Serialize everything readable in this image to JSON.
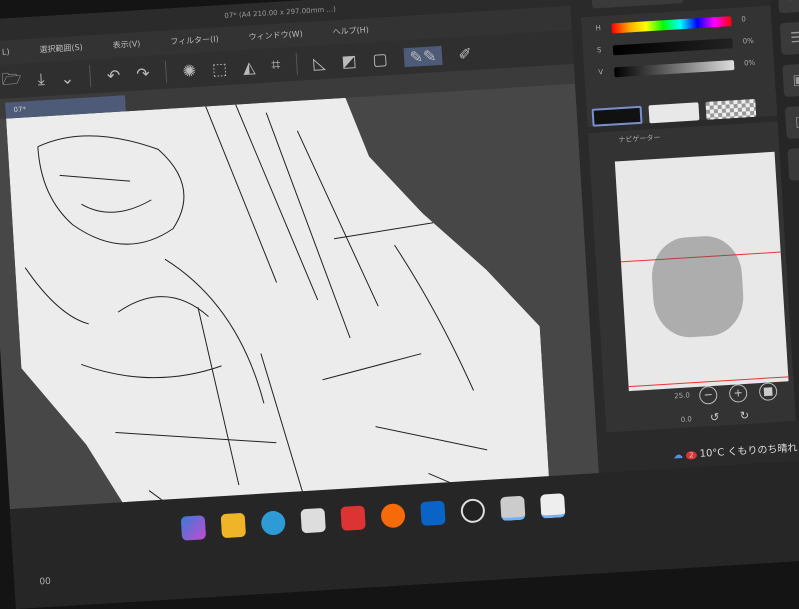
{
  "window": {
    "title": "07* (A4 210.00 x 297.00mm ...)"
  },
  "menu": [
    "L)",
    "選択範囲(S)",
    "表示(V)",
    "フィルター(I)",
    "ウィンドウ(W)",
    "ヘルプ(H)"
  ],
  "tab": {
    "label": "07*"
  },
  "color_panel": {
    "title": "カラースライダー",
    "h_value": "0",
    "s_value": "0%",
    "v_value": "0%",
    "h_label": "H",
    "s_label": "S",
    "v_label": "V"
  },
  "navigator": {
    "title": "ナビゲーター",
    "zoom": "25.0",
    "rotation": "0.0"
  },
  "taskbar": {
    "weather": "10°C くもりのち晴れ",
    "weather_badge": "2",
    "pos_readout": "00"
  },
  "colors": {
    "accent": "#7b8fd0",
    "main_color": "#111111",
    "sub_color": "#e8e8e8"
  }
}
